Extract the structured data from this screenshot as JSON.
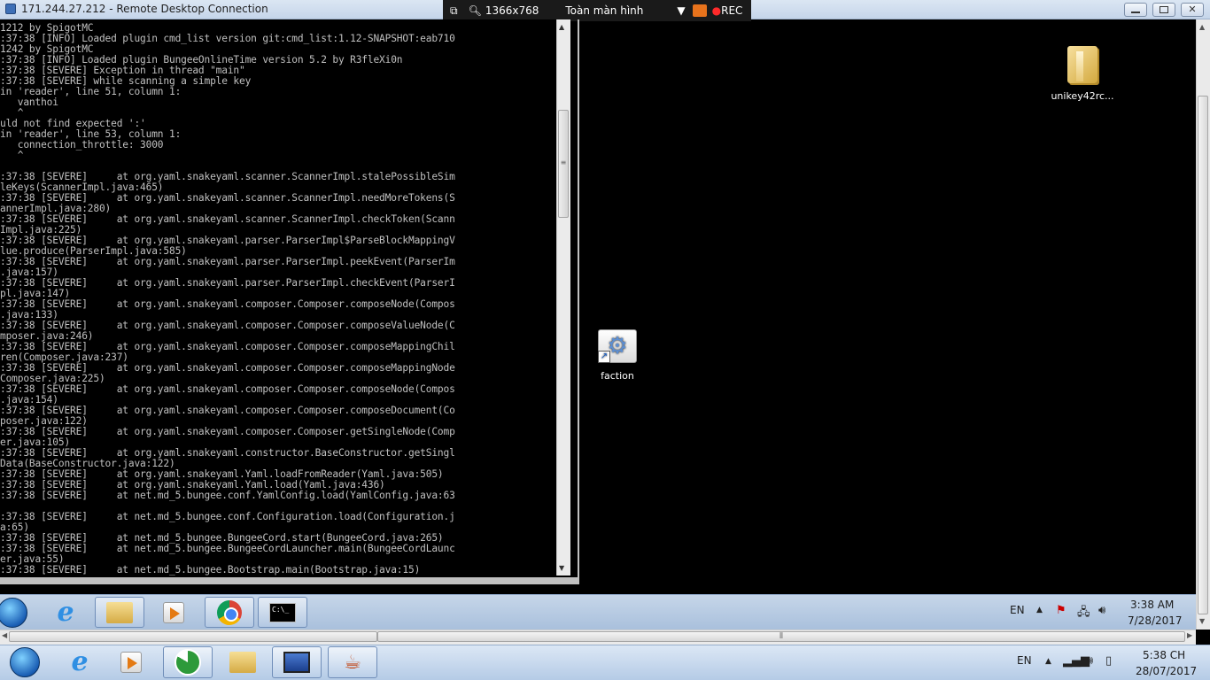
{
  "rdp_window": {
    "title": "171.244.27.212 - Remote Desktop Connection",
    "resolution": "1366x768",
    "mode": "Toàn màn hình",
    "rec_label": "REC"
  },
  "console": {
    "lines": [
      "1212 by SpigotMC",
      ":37:38 [INFO] Loaded plugin cmd_list version git:cmd_list:1.12-SNAPSHOT:eab710",
      "1242 by SpigotMC",
      ":37:38 [INFO] Loaded plugin BungeeOnlineTime version 5.2 by R3fleXi0n",
      ":37:38 [SEVERE] Exception in thread \"main\"",
      ":37:38 [SEVERE] while scanning a simple key",
      "in 'reader', line 51, column 1:",
      "   vanthoi",
      "   ^",
      "uld not find expected ':'",
      "in 'reader', line 53, column 1:",
      "   connection_throttle: 3000",
      "   ^",
      "",
      ":37:38 [SEVERE]     at org.yaml.snakeyaml.scanner.ScannerImpl.stalePossibleSim",
      "leKeys(ScannerImpl.java:465)",
      ":37:38 [SEVERE]     at org.yaml.snakeyaml.scanner.ScannerImpl.needMoreTokens(S",
      "annerImpl.java:280)",
      ":37:38 [SEVERE]     at org.yaml.snakeyaml.scanner.ScannerImpl.checkToken(Scann",
      "Impl.java:225)",
      ":37:38 [SEVERE]     at org.yaml.snakeyaml.parser.ParserImpl$ParseBlockMappingV",
      "lue.produce(ParserImpl.java:585)",
      ":37:38 [SEVERE]     at org.yaml.snakeyaml.parser.ParserImpl.peekEvent(ParserIm",
      ".java:157)",
      ":37:38 [SEVERE]     at org.yaml.snakeyaml.parser.ParserImpl.checkEvent(ParserI",
      "pl.java:147)",
      ":37:38 [SEVERE]     at org.yaml.snakeyaml.composer.Composer.composeNode(Compos",
      ".java:133)",
      ":37:38 [SEVERE]     at org.yaml.snakeyaml.composer.Composer.composeValueNode(C",
      "mposer.java:246)",
      ":37:38 [SEVERE]     at org.yaml.snakeyaml.composer.Composer.composeMappingChil",
      "ren(Composer.java:237)",
      ":37:38 [SEVERE]     at org.yaml.snakeyaml.composer.Composer.composeMappingNode",
      "Composer.java:225)",
      ":37:38 [SEVERE]     at org.yaml.snakeyaml.composer.Composer.composeNode(Compos",
      ".java:154)",
      ":37:38 [SEVERE]     at org.yaml.snakeyaml.composer.Composer.composeDocument(Co",
      "poser.java:122)",
      ":37:38 [SEVERE]     at org.yaml.snakeyaml.composer.Composer.getSingleNode(Comp",
      "er.java:105)",
      ":37:38 [SEVERE]     at org.yaml.snakeyaml.constructor.BaseConstructor.getSingl",
      "Data(BaseConstructor.java:122)",
      ":37:38 [SEVERE]     at org.yaml.snakeyaml.Yaml.loadFromReader(Yaml.java:505)",
      ":37:38 [SEVERE]     at org.yaml.snakeyaml.Yaml.load(Yaml.java:436)",
      ":37:38 [SEVERE]     at net.md_5.bungee.conf.YamlConfig.load(YamlConfig.java:63",
      "",
      ":37:38 [SEVERE]     at net.md_5.bungee.conf.Configuration.load(Configuration.j",
      "a:65)",
      ":37:38 [SEVERE]     at net.md_5.bungee.BungeeCord.start(BungeeCord.java:265)",
      ":37:38 [SEVERE]     at net.md_5.bungee.BungeeCordLauncher.main(BungeeCordLaunc",
      "er.java:55)",
      ":37:38 [SEVERE]     at net.md_5.bungee.Bootstrap.main(Bootstrap.java:15)"
    ]
  },
  "desktop_icons": {
    "unikey": "unikey42rc...",
    "faction": "faction"
  },
  "remote_taskbar": {
    "language": "EN",
    "time": "3:38 AM",
    "date": "7/28/2017"
  },
  "local_taskbar": {
    "language": "EN",
    "time": "5:38 CH",
    "date": "28/07/2017"
  }
}
